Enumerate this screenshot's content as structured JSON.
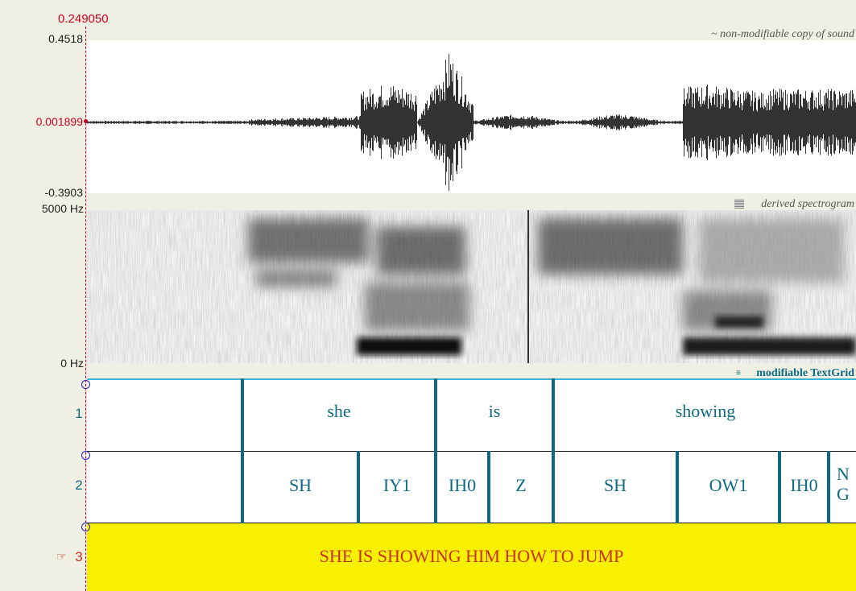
{
  "cursor": {
    "time": "0.249050"
  },
  "waveform": {
    "title": "~ non-modifiable copy of sound",
    "y_max": "0.4518",
    "y_cursor": "0.001899",
    "y_min": "-0.3903"
  },
  "spectrogram": {
    "title": "derived spectrogram",
    "freq_max": "5000 Hz",
    "freq_min": "0 Hz"
  },
  "textgrid": {
    "title": "modifiable TextGrid",
    "tiers": [
      {
        "number": "1",
        "intervals": [
          "",
          "she",
          "is",
          "showing"
        ]
      },
      {
        "number": "2",
        "intervals": [
          "",
          "SH",
          "IY1",
          "IH0",
          "Z",
          "SH",
          "OW1",
          "IH0",
          "N\nG"
        ]
      },
      {
        "number": "3",
        "pointer": "☞",
        "intervals": [
          "SHE IS SHOWING HIM HOW TO JUMP"
        ]
      }
    ]
  },
  "colors": {
    "cursor_red": "#c8001e",
    "tier_teal": "#0d6a82",
    "selected_tier_yellow": "#f7f000",
    "selection_text": "#c8321e",
    "textgrid_top_line": "#3ab4d2"
  },
  "icons": {
    "pointer": "pointing-hand-icon",
    "spectrogram": "spectrogram-icon",
    "textgrid": "textgrid-icon"
  }
}
